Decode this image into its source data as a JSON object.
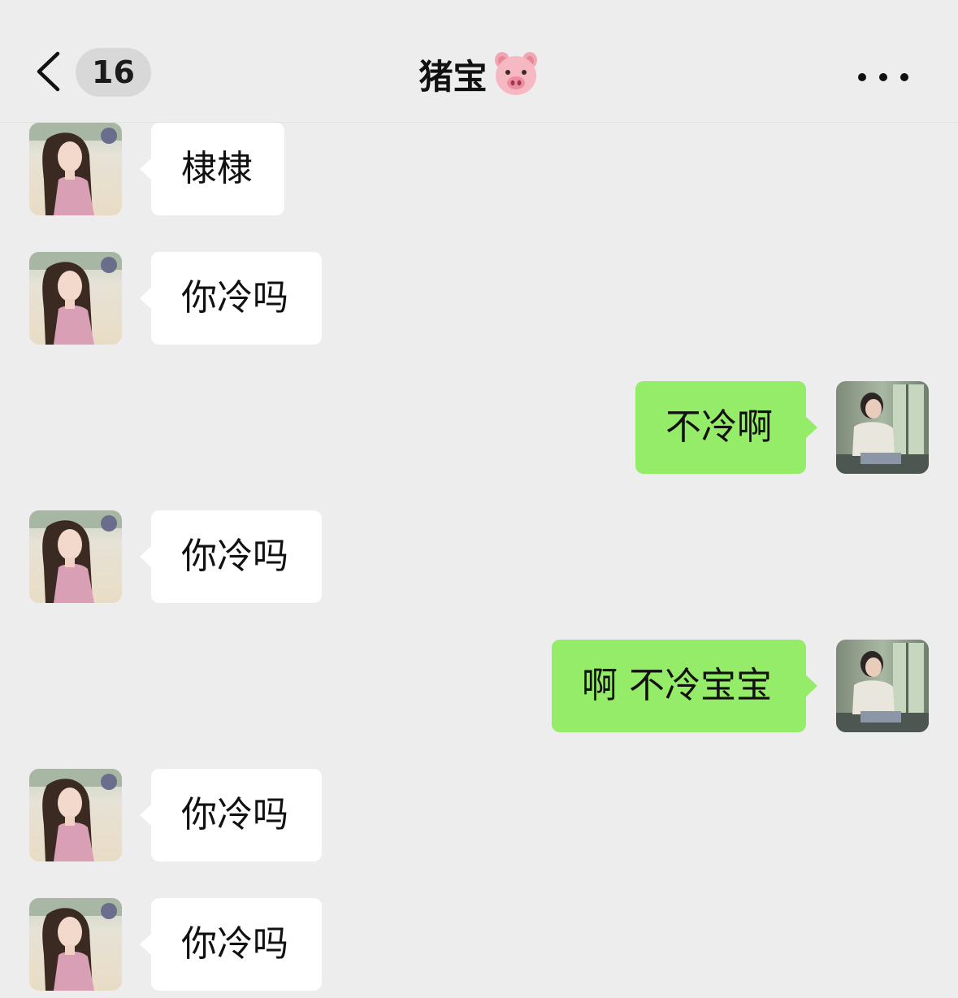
{
  "header": {
    "unread_count": "16",
    "title": "猪宝"
  },
  "icons": {
    "back": "chevron-left-icon",
    "title_emoji": "pig-face-icon",
    "more": "more-dots-icon"
  },
  "colors": {
    "background": "#ededed",
    "incoming_bubble": "#ffffff",
    "outgoing_bubble": "#95ec69"
  },
  "messages": [
    {
      "direction": "incoming",
      "text": "棣棣"
    },
    {
      "direction": "incoming",
      "text": "你冷吗"
    },
    {
      "direction": "outgoing",
      "text": "不冷啊"
    },
    {
      "direction": "incoming",
      "text": "你冷吗"
    },
    {
      "direction": "outgoing",
      "text": "啊 不冷宝宝"
    },
    {
      "direction": "incoming",
      "text": "你冷吗"
    },
    {
      "direction": "incoming",
      "text": "你冷吗"
    }
  ]
}
